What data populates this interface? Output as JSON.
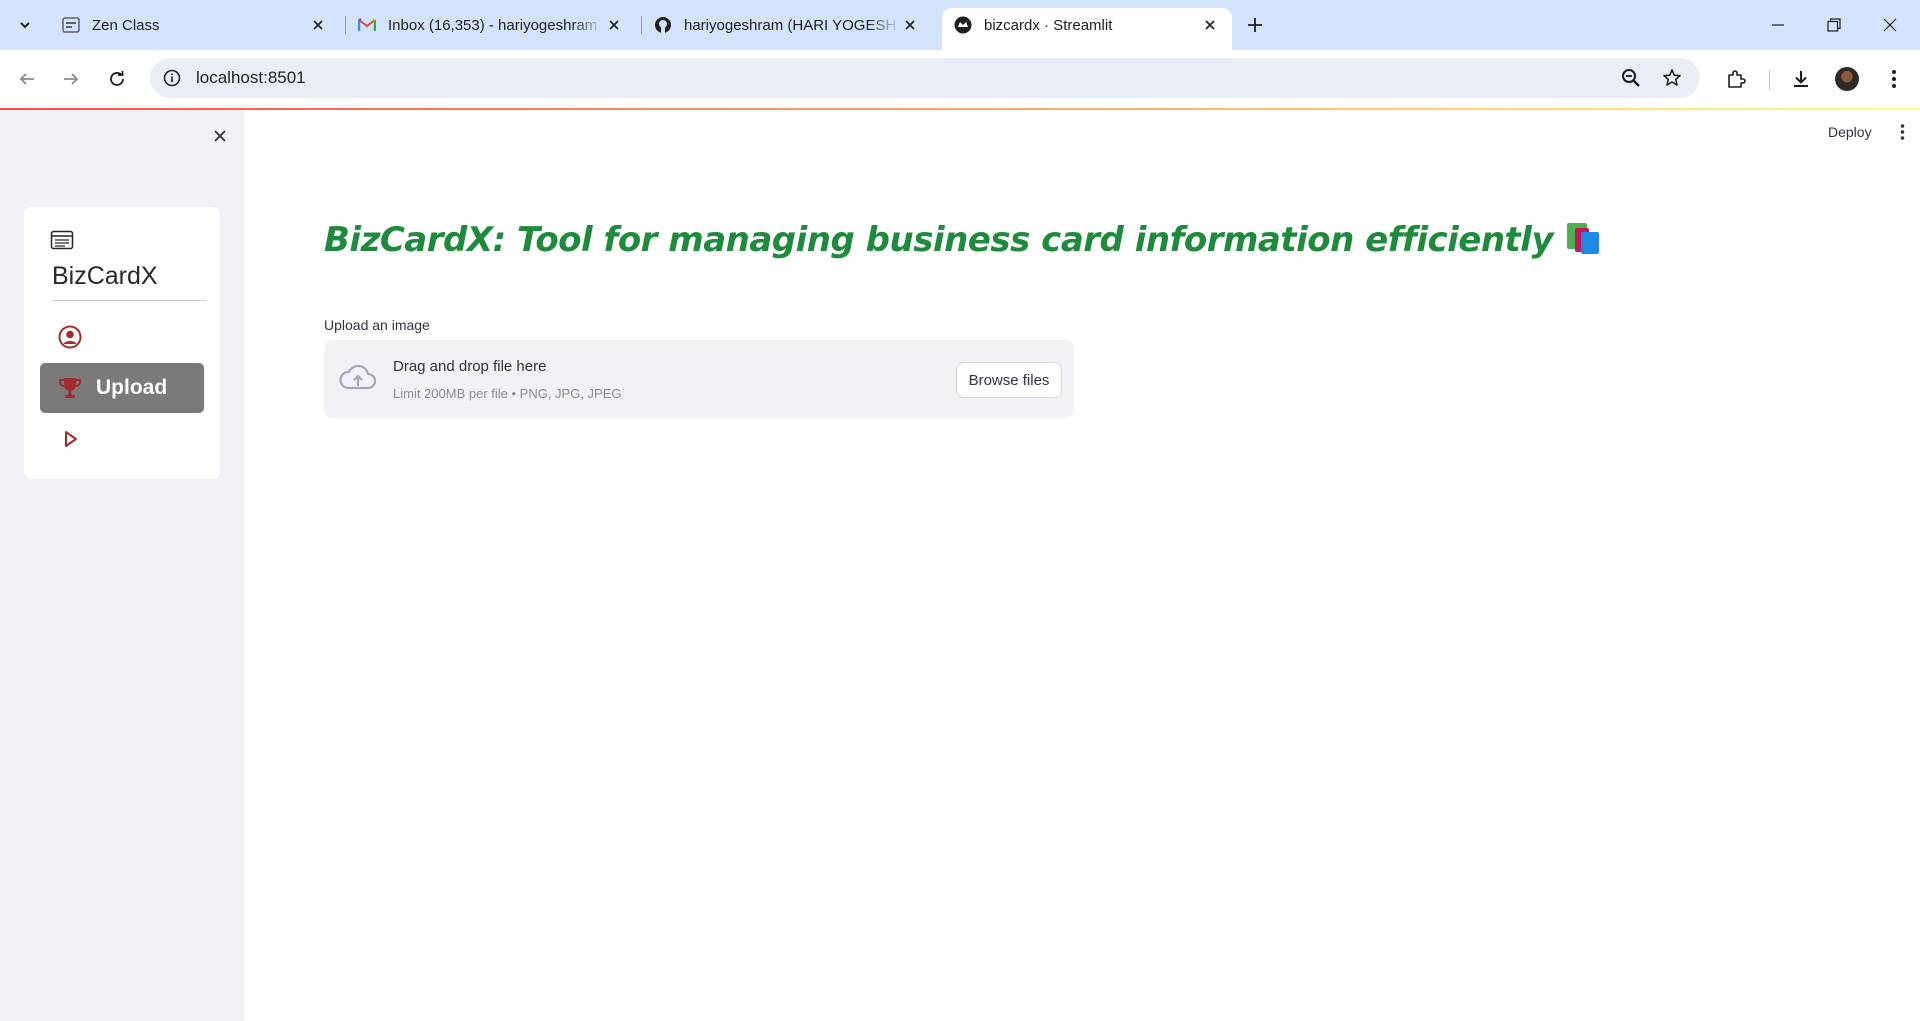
{
  "browser": {
    "tabs": [
      {
        "title": "Zen Class",
        "favicon": "zen-class-icon"
      },
      {
        "title": "Inbox (16,353) - hariyogeshram",
        "favicon": "gmail-icon"
      },
      {
        "title": "hariyogeshram (HARI YOGESH R",
        "favicon": "github-icon"
      },
      {
        "title": "bizcardx · Streamlit",
        "favicon": "streamlit-icon",
        "active": true
      }
    ],
    "url": "localhost:8501"
  },
  "header": {
    "deploy_label": "Deploy"
  },
  "sidebar": {
    "menu_title": "BizCardX",
    "items": [
      {
        "label": "",
        "icon": "person-circle-icon",
        "selected": false
      },
      {
        "label": "Upload",
        "icon": "trophy-icon",
        "selected": true
      },
      {
        "label": "",
        "icon": "play-icon",
        "selected": false
      }
    ]
  },
  "main": {
    "title": "BizCardX: Tool for managing business card information efficiently",
    "title_emoji": "books-icon",
    "uploader": {
      "label": "Upload an image",
      "drop_text": "Drag and drop file here",
      "limit_text": "Limit 200MB per file • PNG, JPG, JPEG",
      "browse_label": "Browse files"
    }
  },
  "colors": {
    "title_green": "#1e8a3c",
    "icon_red": "#a52a2a",
    "selected_item_bg": "#7a7a7a",
    "sidebar_bg": "#f0f2f6",
    "tabstrip_bg": "#d3e3fd"
  }
}
